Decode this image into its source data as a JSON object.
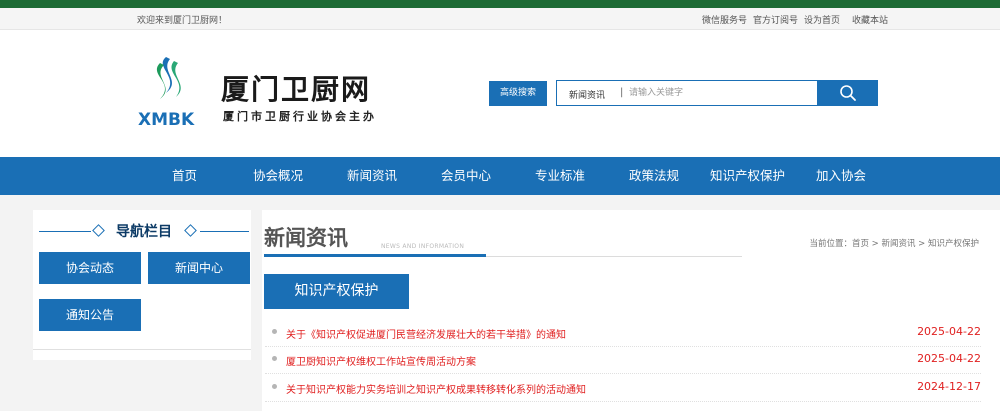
{
  "topbar": {
    "welcome": "欢迎来到厦门卫厨网！",
    "links": [
      "微信服务号",
      "官方订阅号",
      "设为首页",
      "收藏本站"
    ]
  },
  "logo": {
    "abbr": "XMBK",
    "title": "厦门卫厨网",
    "subtitle": "厦门市卫厨行业协会主办"
  },
  "search": {
    "advanced_label": "高级搜索",
    "category": "新闻资讯",
    "separator": "|",
    "placeholder": "请输入关键字"
  },
  "nav": {
    "items": [
      "首页",
      "协会概况",
      "新闻资讯",
      "会员中心",
      "专业标准",
      "政策法规",
      "知识产权保护",
      "加入协会"
    ]
  },
  "sidebar": {
    "title": "导航栏目",
    "buttons": [
      "协会动态",
      "新闻中心",
      "通知公告"
    ]
  },
  "main": {
    "title": "新闻资讯",
    "title_en": "NEWS AND INFORMATION",
    "breadcrumb": "当前位置：首页 > 新闻资讯 > 知识产权保护",
    "category": "知识产权保护",
    "news": [
      {
        "title": "关于《知识产权促进厦门民营经济发展壮大的若干举措》的通知",
        "date": "2025-04-22"
      },
      {
        "title": "厦卫厨知识产权维权工作站宣传周活动方案",
        "date": "2025-04-22"
      },
      {
        "title": "关于知识产权能力实务培训之知识产权成果转移转化系列的活动通知",
        "date": "2024-12-17"
      }
    ]
  },
  "colors": {
    "primary": "#1a6fb5",
    "topbar_green": "#1d6b35",
    "news_red": "#e02020"
  }
}
